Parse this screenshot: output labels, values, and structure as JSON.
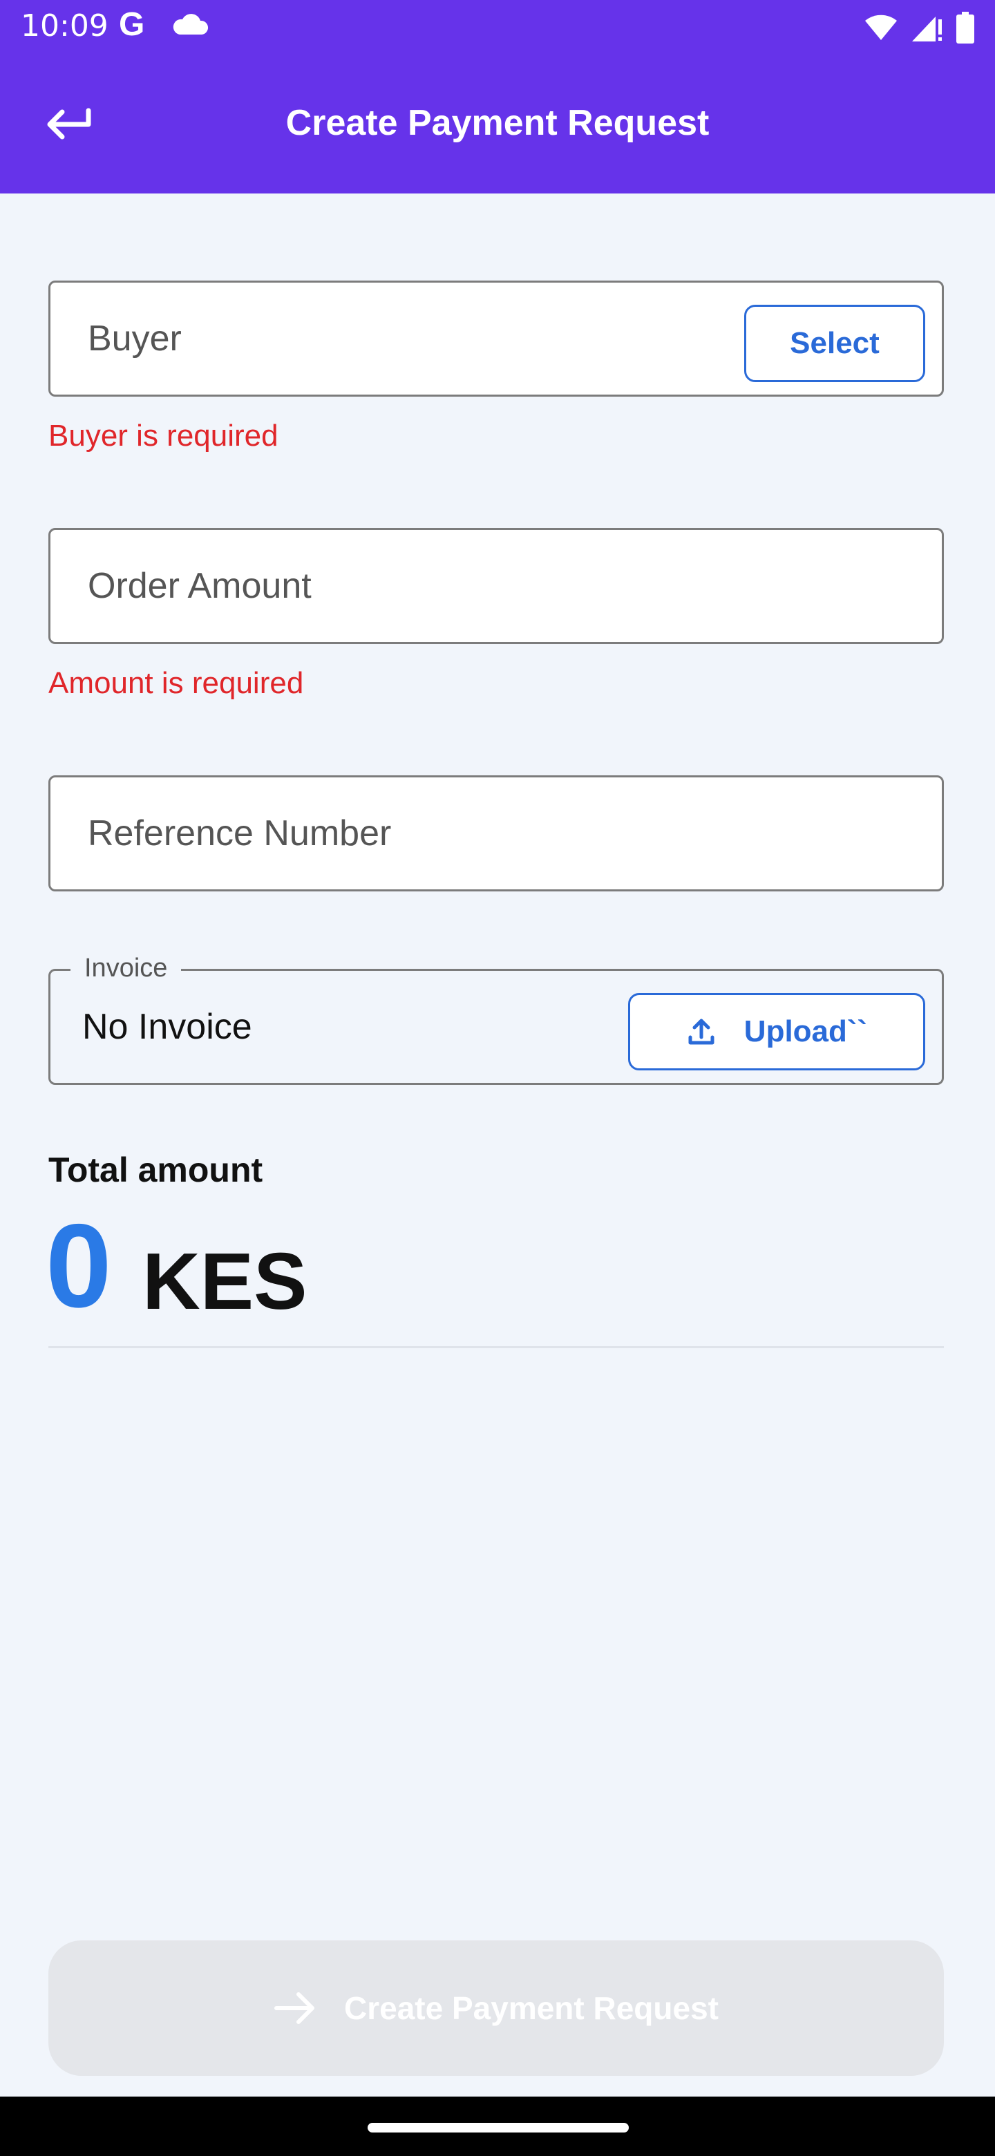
{
  "status_bar": {
    "time": "10:09",
    "icons": [
      "google-icon",
      "cloud-icon",
      "wifi-icon",
      "signal-icon",
      "battery-icon"
    ]
  },
  "app_bar": {
    "title": "Create Payment Request",
    "back_icon": "back-arrow-icon"
  },
  "form": {
    "buyer": {
      "placeholder": "Buyer",
      "select_label": "Select",
      "error": "Buyer is required"
    },
    "order_amount": {
      "placeholder": "Order Amount",
      "error": "Amount is required"
    },
    "reference_number": {
      "placeholder": "Reference Number"
    },
    "invoice": {
      "legend": "Invoice",
      "value": "No Invoice",
      "upload_label": "Upload``",
      "upload_icon": "upload-icon"
    }
  },
  "total": {
    "label": "Total amount",
    "amount": "0",
    "currency": "KES"
  },
  "submit": {
    "label": "Create Payment Request",
    "icon": "arrow-right-icon"
  },
  "colors": {
    "app_bar": "#6633ea",
    "accent": "#2a6ad8",
    "error": "#e0262a",
    "amount": "#2a7ae6",
    "disabled_button": "#e4e6ea"
  }
}
